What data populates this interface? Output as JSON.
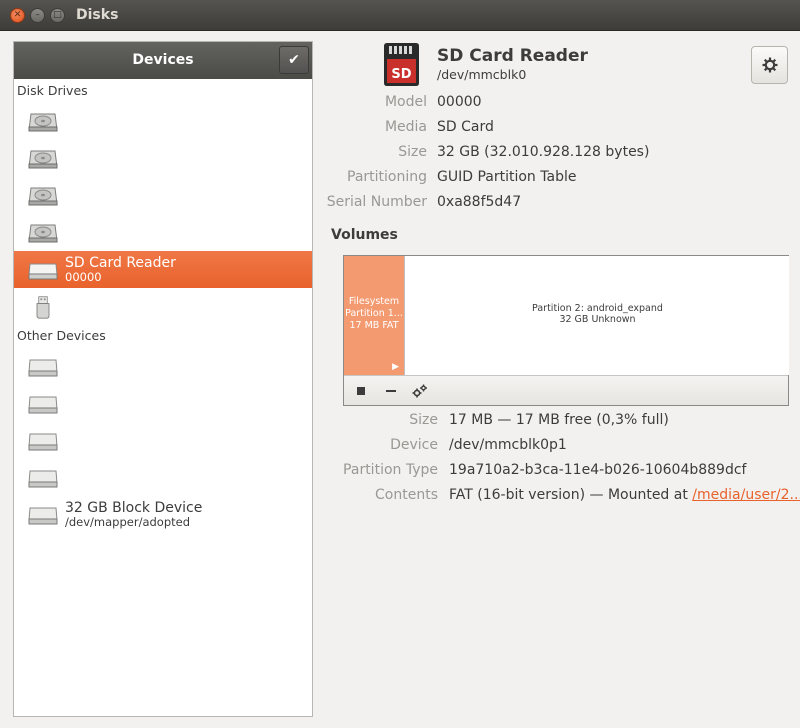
{
  "window": {
    "title": "Disks"
  },
  "sidebar": {
    "header": "Devices",
    "sections": [
      {
        "label": "Disk Drives",
        "items": [
          {
            "icon": "hard-disk-icon",
            "name": "",
            "sub": ""
          },
          {
            "icon": "hard-disk-icon",
            "name": "",
            "sub": ""
          },
          {
            "icon": "hard-disk-icon",
            "name": "",
            "sub": ""
          },
          {
            "icon": "hard-disk-icon",
            "name": "",
            "sub": ""
          },
          {
            "icon": "removable-drive-icon",
            "name": "SD Card Reader",
            "sub": "00000",
            "selected": true
          },
          {
            "icon": "usb-stick-icon",
            "name": "",
            "sub": ""
          }
        ]
      },
      {
        "label": "Other Devices",
        "items": [
          {
            "icon": "block-device-icon",
            "name": "",
            "sub": ""
          },
          {
            "icon": "block-device-icon",
            "name": "",
            "sub": ""
          },
          {
            "icon": "block-device-icon",
            "name": "",
            "sub": ""
          },
          {
            "icon": "block-device-icon",
            "name": "",
            "sub": ""
          },
          {
            "icon": "block-device-icon",
            "name": "32 GB Block Device",
            "sub": "/dev/mapper/adopted"
          }
        ]
      }
    ]
  },
  "device": {
    "title": "SD Card Reader",
    "path": "/dev/mmcblk0",
    "icon": "sd-card-icon",
    "icon_text": "SD",
    "props": [
      {
        "key": "Model",
        "value": "00000"
      },
      {
        "key": "Media",
        "value": "SD Card"
      },
      {
        "key": "Size",
        "value": "32 GB (32.010.928.128 bytes)"
      },
      {
        "key": "Partitioning",
        "value": "GUID Partition Table"
      },
      {
        "key": "Serial Number",
        "value": "0xa88f5d47"
      }
    ]
  },
  "volumes": {
    "heading": "Volumes",
    "partitions": [
      {
        "lines": [
          "Filesystem",
          "Partition 1...",
          "17 MB FAT"
        ],
        "selected": true
      },
      {
        "lines": [
          "Partition 2: android_expand",
          "32 GB Unknown"
        ],
        "selected": false
      }
    ],
    "details": [
      {
        "key": "Size",
        "value": "17 MB — 17 MB free (0,3% full)"
      },
      {
        "key": "Device",
        "value": "/dev/mmcblk0p1"
      },
      {
        "key": "Partition Type",
        "value": "19a710a2-b3ca-11e4-b026-10604b889dcf"
      },
      {
        "key": "Contents",
        "value": "FAT (16-bit version) — Mounted at ",
        "link": "/media/user/2..."
      }
    ]
  },
  "colors": {
    "accent": "#e8622c",
    "partition_selected": "#f39a71",
    "header_dark": "#4a4a47"
  }
}
